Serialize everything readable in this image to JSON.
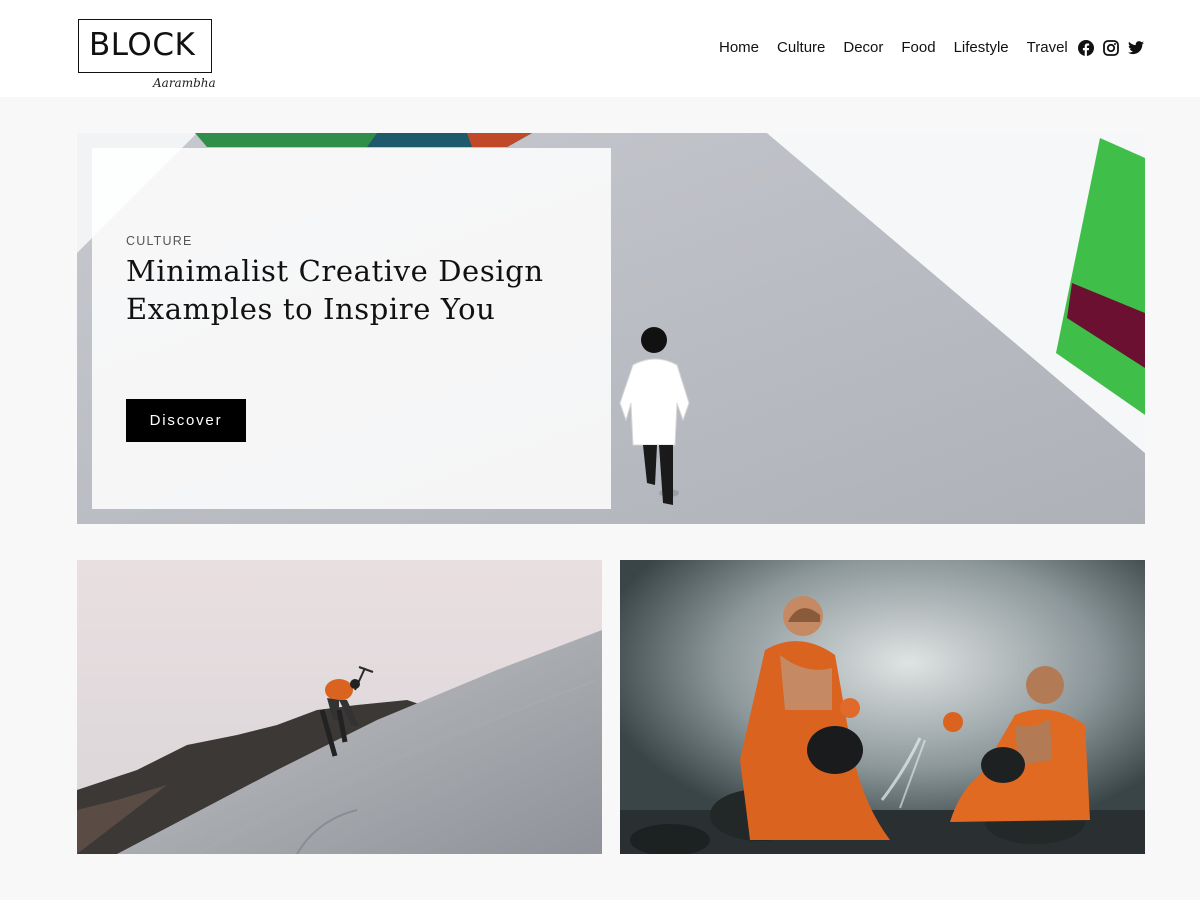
{
  "header": {
    "logo": {
      "main": "BLOCK",
      "sub": "Aarambha"
    },
    "nav": [
      {
        "label": "Home"
      },
      {
        "label": "Culture"
      },
      {
        "label": "Decor"
      },
      {
        "label": "Food"
      },
      {
        "label": "Lifestyle"
      },
      {
        "label": "Travel"
      }
    ],
    "social": [
      {
        "icon": "facebook-icon"
      },
      {
        "icon": "instagram-icon"
      },
      {
        "icon": "twitter-icon"
      }
    ]
  },
  "hero": {
    "category": "CULTURE",
    "title_line1": "Minimalist Creative Design",
    "title_line2": "Examples to Inspire You",
    "button_label": "Discover"
  },
  "colors": {
    "page_bg": "#f8f8f8",
    "header_bg": "#ffffff",
    "button_bg": "#000000",
    "accent_green": "#3fbf4a",
    "accent_maroon": "#6b1030",
    "robe_orange": "#d9631f"
  }
}
